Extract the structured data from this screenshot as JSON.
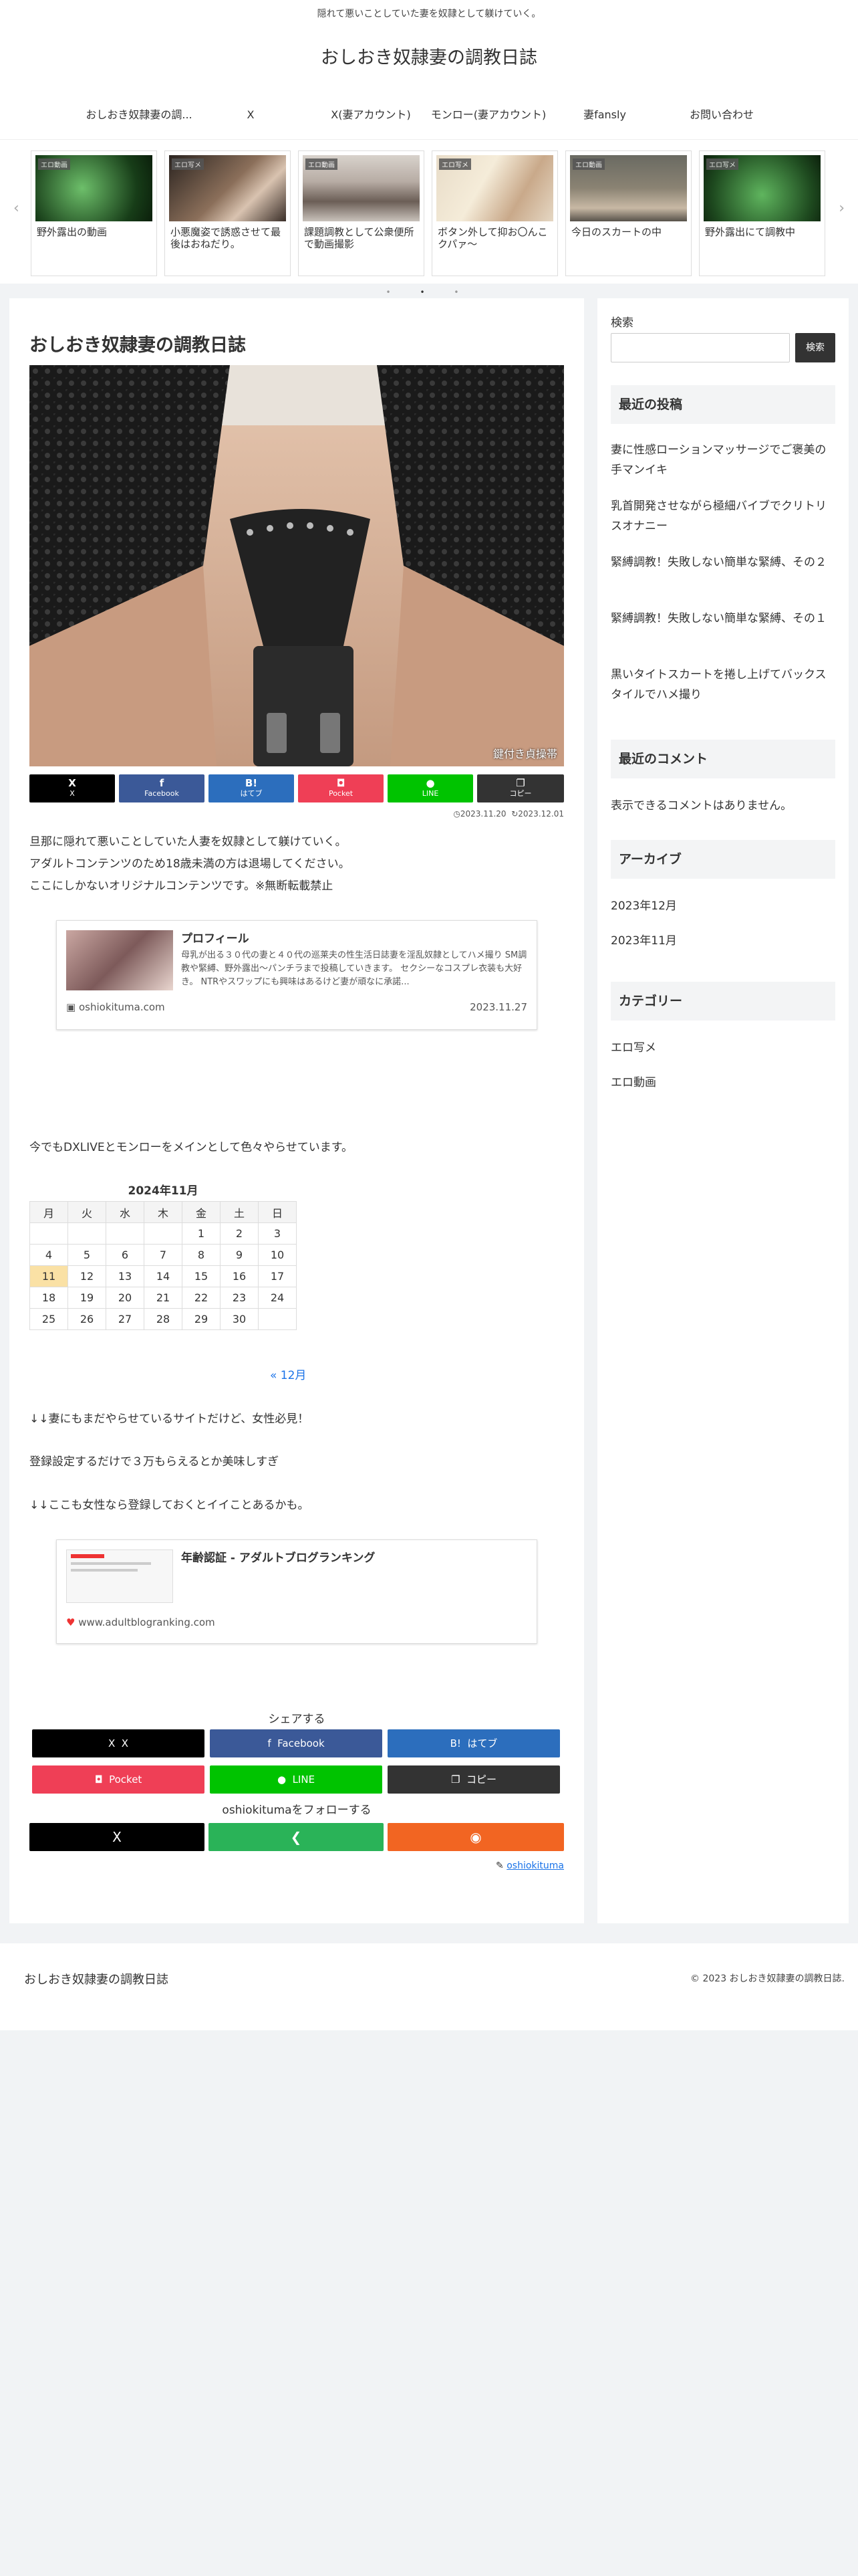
{
  "header": {
    "tagline": "隠れて悪いことしていた妻を奴隷として躾けていく。",
    "site_title": "おしおき奴隷妻の調教日誌"
  },
  "nav": [
    "おしおき奴隷妻の調...",
    "X",
    "X(妻アカウント)",
    "モンロー(妻アカウント)",
    "妻fansly",
    "お問い合わせ"
  ],
  "carousel": [
    {
      "category": "エロ動画",
      "title": "野外露出の動画"
    },
    {
      "category": "エロ写メ",
      "title": "小悪魔姿で誘惑させて最後はおねだり。"
    },
    {
      "category": "エロ動画",
      "title": "課題調教として公衆便所で動画撮影"
    },
    {
      "category": "エロ写メ",
      "title": "ボタン外して抑お〇んこクパァ〜"
    },
    {
      "category": "エロ動画",
      "title": "今日のスカートの中"
    },
    {
      "category": "エロ写メ",
      "title": "野外露出にて調教中"
    }
  ],
  "post": {
    "title": "おしおき奴隷妻の調教日誌",
    "image_caption": "鍵付き貞操帯",
    "share_top": [
      {
        "icon": "X",
        "label": "X",
        "color": "#000000"
      },
      {
        "icon": "f",
        "label": "Facebook",
        "color": "#3b5998"
      },
      {
        "icon": "B!",
        "label": "はてブ",
        "color": "#2c6ebd"
      },
      {
        "icon": "◘",
        "label": "Pocket",
        "color": "#ef3f56"
      },
      {
        "icon": "●",
        "label": "LINE",
        "color": "#00c300"
      },
      {
        "icon": "❐",
        "label": "コピー",
        "color": "#333333"
      }
    ],
    "date_published": "2023.11.20",
    "date_updated": "2023.12.01",
    "intro": [
      "旦那に隠れて悪いことしていた人妻を奴隷として躾けていく。",
      "アダルトコンテンツのため18歳未満の方は退場してください。",
      "ここにしかないオリジナルコンテンツです。※無断転載禁止"
    ],
    "profile_card": {
      "title": "プロフィール",
      "snippet": "母乳が出る３０代の妻と４０代の巡莱夫の性生活日誌妻を淫乱奴隷としてハメ撮り SM調教や緊縛、野外露出〜パンチラまで投稿していきます。 セクシーなコスプレ衣装も大好き。 NTRやスワップにも興味はあるけど妻が頑なに承諾...",
      "domain": "oshiokituma.com",
      "date": "2023.11.27"
    },
    "monroe_text": "今でもDXLIVEとモンローをメインとして色々やらせています。",
    "calendar": {
      "title": "2024年11月",
      "weekdays": [
        "月",
        "火",
        "水",
        "木",
        "金",
        "土",
        "日"
      ],
      "rows": [
        [
          "",
          "",
          "",
          "",
          "1",
          "2",
          "3"
        ],
        [
          "4",
          "5",
          "6",
          "7",
          "8",
          "9",
          "10"
        ],
        [
          "11",
          "12",
          "13",
          "14",
          "15",
          "16",
          "17"
        ],
        [
          "18",
          "19",
          "20",
          "21",
          "22",
          "23",
          "24"
        ],
        [
          "25",
          "26",
          "27",
          "28",
          "29",
          "30",
          ""
        ]
      ],
      "today": "11",
      "next_link": "« 12月"
    },
    "after1": "↓↓妻にもまだやらせているサイトだけど、女性必見！",
    "after2": "登録設定するだけで３万もらえるとか美味しすぎ",
    "after3": "↓↓ここも女性なら登録しておくとイイことあるかも。",
    "ranking_card": {
      "title": "年齢認証 - アダルトブログランキング",
      "domain": "www.adultblogranking.com"
    },
    "share_heading": "シェアする",
    "share_bottom": [
      {
        "icon": "X",
        "label": "X",
        "color": "#000000"
      },
      {
        "icon": "f",
        "label": "Facebook",
        "color": "#3b5998"
      },
      {
        "icon": "B!",
        "label": "はてブ",
        "color": "#2c6ebd"
      },
      {
        "icon": "◘",
        "label": "Pocket",
        "color": "#ef3f56"
      },
      {
        "icon": "●",
        "label": "LINE",
        "color": "#00c300"
      },
      {
        "icon": "❐",
        "label": "コピー",
        "color": "#333333"
      }
    ],
    "follow_heading": "oshiokitumaをフォローする",
    "follow_buttons": [
      {
        "icon": "X",
        "color": "#000000"
      },
      {
        "icon": "❮",
        "color": "#2ab358"
      },
      {
        "icon": "◉",
        "color": "#f26522"
      }
    ],
    "author": "oshiokituma"
  },
  "sidebar": {
    "search_label": "検索",
    "search_button": "検索",
    "recent_heading": "最近の投稿",
    "recent_posts": [
      "妻に性感ローションマッサージでご褒美の手マンイキ",
      "乳首開発させながら極細バイブでクリトリスオナニー",
      "緊縛調教！失敗しない簡単な緊縛、その２",
      "緊縛調教！失敗しない簡単な緊縛、その１",
      "黒いタイトスカートを捲し上げてバックスタイルでハメ撮り"
    ],
    "comments_heading": "最近のコメント",
    "comments_empty": "表示できるコメントはありません。",
    "archive_heading": "アーカイブ",
    "archives": [
      "2023年12月",
      "2023年11月"
    ],
    "category_heading": "カテゴリー",
    "categories": [
      "エロ写メ",
      "エロ動画"
    ]
  },
  "footer": {
    "title": "おしおき奴隷妻の調教日誌",
    "copyright": "© 2023 おしおき奴隷妻の調教日誌."
  }
}
